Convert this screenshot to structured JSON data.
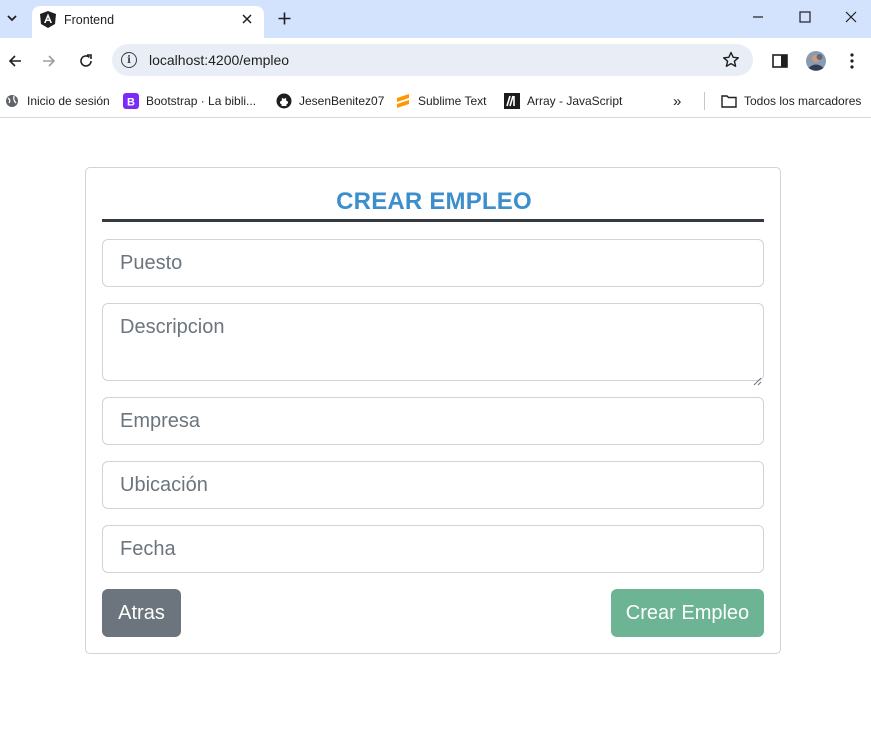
{
  "browser": {
    "tab_title": "Frontend",
    "url": "localhost:4200/empleo",
    "bookmarks": [
      {
        "label": "Inicio de sesión",
        "icon": "globe-icon"
      },
      {
        "label": "Bootstrap · La bibli...",
        "icon": "bootstrap-icon"
      },
      {
        "label": "JesenBenitez07",
        "icon": "github-icon"
      },
      {
        "label": "Sublime Text",
        "icon": "sublime-icon"
      },
      {
        "label": "Array - JavaScript",
        "icon": "mdn-icon"
      }
    ],
    "all_bookmarks": "Todos los marcadores",
    "overflow": "»"
  },
  "form": {
    "title": "CREAR EMPLEO",
    "puesto_placeholder": "Puesto",
    "descripcion_placeholder": "Descripcion",
    "empresa_placeholder": "Empresa",
    "ubicacion_placeholder": "Ubicación",
    "fecha_placeholder": "Fecha",
    "back_label": "Atras",
    "create_label": "Crear Empleo"
  },
  "colors": {
    "title": "#3d8fcc",
    "back_button": "#6c757d",
    "create_button": "#6cb493",
    "tabstrip": "#d3e3fd"
  }
}
